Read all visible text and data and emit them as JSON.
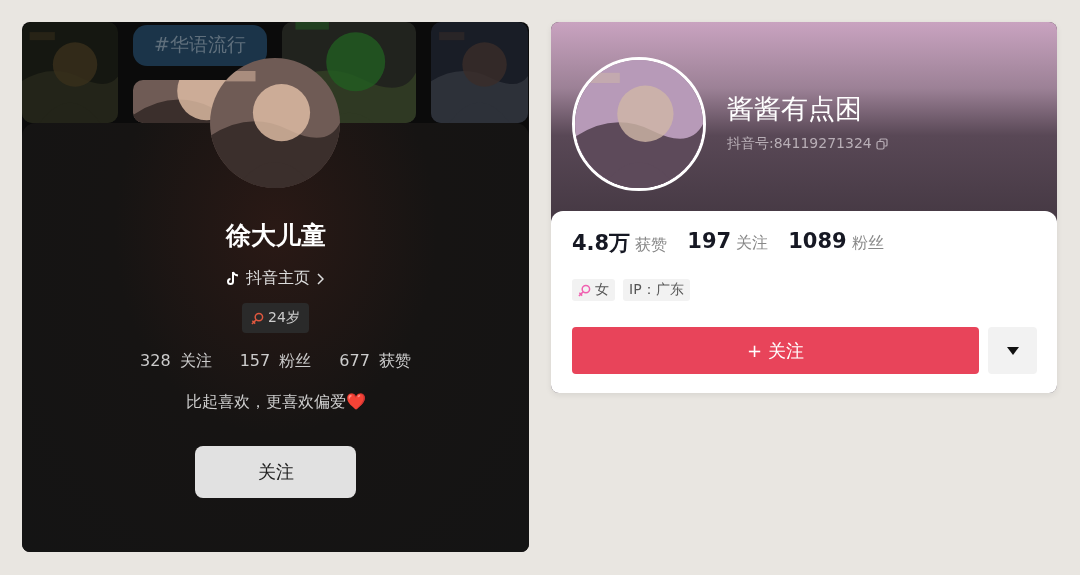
{
  "left_card": {
    "collage": [
      {
        "kind": "picture"
      },
      {
        "kind": "tag",
        "label": "#华语流行"
      },
      {
        "kind": "picture"
      },
      {
        "kind": "picture"
      }
    ],
    "name": "徐大儿童",
    "link": "抖音主页",
    "age": "24岁",
    "stats": [
      "328 关注",
      "157 粉丝",
      "677 获赞"
    ],
    "bio": "比起喜欢，更喜欢偏爱❤️",
    "follow_button": "关注"
  },
  "right_card": {
    "name": "酱酱有点困",
    "id": "抖音号:84119271324",
    "stats": [
      "**4.8万** 获赞",
      "**197** 关注",
      "**1089** 粉丝"
    ],
    "tags": [
      {
        "kind": "gender",
        "label": "女"
      },
      {
        "kind": "text",
        "label": "IP：广东"
      }
    ],
    "follow_button": "+ 关注"
  }
}
